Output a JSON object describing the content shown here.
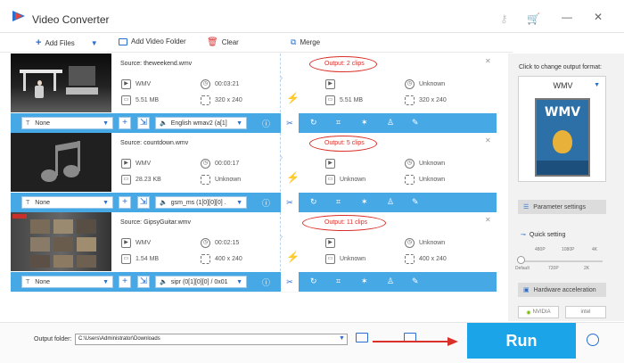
{
  "window": {
    "title": "Video Converter"
  },
  "toolbar": {
    "add_files": "Add Files",
    "add_video_folder": "Add Video Folder",
    "clear": "Clear",
    "merge": "Merge"
  },
  "tasks": [
    {
      "source": "Source: theweekend.wmv",
      "src_format": "WMV",
      "src_duration": "00:03:21",
      "src_size": "5.51 MB",
      "src_resolution": "320 x 240",
      "output": "Output: 2 clips",
      "out_format": "Unknown",
      "out_size": "5.51 MB",
      "out_resolution": "320 x 240",
      "subtitle": "None",
      "audio": "English wmav2 (a[1]"
    },
    {
      "source": "Source: countdown.wmv",
      "src_format": "WMV",
      "src_duration": "00:00:17",
      "src_size": "28.23 KB",
      "src_resolution": "Unknown",
      "output": "Output: 5 clips",
      "out_format": "Unknown",
      "out_size": "Unknown",
      "out_resolution": "Unknown",
      "subtitle": "None",
      "audio": "gsm_ms (1[0][0][0] ."
    },
    {
      "source": "Source: GipsyGuitar.wmv",
      "src_format": "WMV",
      "src_duration": "00:02:15",
      "src_size": "1.54 MB",
      "src_resolution": "400 x 240",
      "output": "Output: 11 clips",
      "out_format": "Unknown",
      "out_size": "Unknown",
      "out_resolution": "400 x 240",
      "subtitle": "None",
      "audio": "sipr (0[1][0][0] / 0x01"
    }
  ],
  "right_panel": {
    "title": "Click to change output format:",
    "format": "WMV",
    "format_badge": "WMV",
    "parameter_settings": "Parameter settings",
    "quick_setting": "Quick setting",
    "qs_top_ticks": [
      "480P",
      "1080P",
      "4K"
    ],
    "qs_bottom_ticks": [
      "Default",
      "720P",
      "2K"
    ],
    "hardware_acceleration": "Hardware acceleration",
    "nvidia": "NVIDIA",
    "intel": "intel"
  },
  "bottom": {
    "output_folder_label": "Output folder:",
    "output_folder_value": "C:\\Users\\Administrator\\Downloads",
    "run": "Run"
  }
}
